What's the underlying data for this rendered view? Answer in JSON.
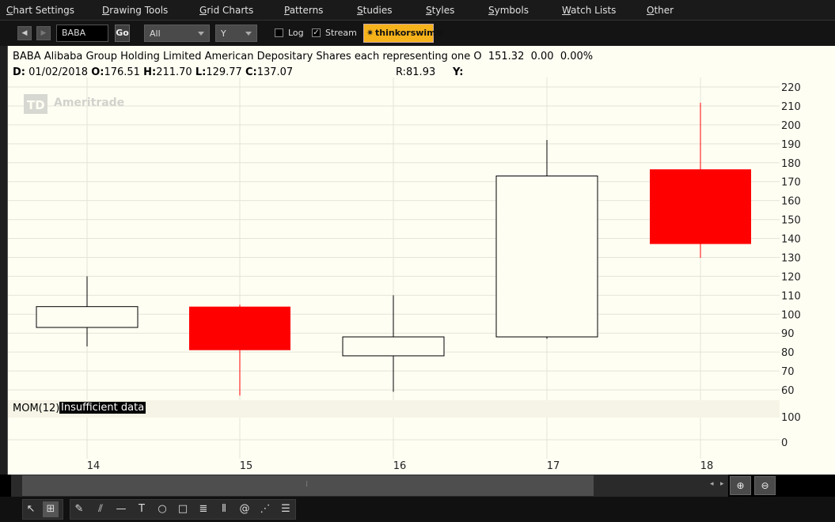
{
  "menu": [
    {
      "label": "Chart Settings",
      "ul": "C",
      "rest": "hart Settings"
    },
    {
      "label": "Drawing Tools",
      "ul": "D",
      "rest": "rawing Tools"
    },
    {
      "label": "Grid Charts",
      "ul": "G",
      "rest": "rid Charts"
    },
    {
      "label": "Patterns",
      "ul": "P",
      "rest": "atterns"
    },
    {
      "label": "Studies",
      "ul": "S",
      "rest": "tudies"
    },
    {
      "label": "Styles",
      "ul": "S",
      "rest": "tyles"
    },
    {
      "label": "Symbols",
      "ul": "S",
      "rest": "ymbols"
    },
    {
      "label": "Watch Lists",
      "ul": "W",
      "rest": "atch Lists"
    },
    {
      "label": "Other",
      "ul": "O",
      "rest": "ther"
    }
  ],
  "toolbar": {
    "symbol_value": "BABA",
    "go_label": "Go",
    "period_value": "All",
    "aggregation_value": "Y",
    "log_label": "Log",
    "log_checked": false,
    "stream_label": "Stream",
    "stream_checked": true,
    "brand_label": "thinkorswim®"
  },
  "header": {
    "title_line": "BABA Alibaba Group Holding Limited American Depositary Shares each representing one O",
    "last": "151.32",
    "change": "0.00",
    "change_pct": "0.00%",
    "date_label": "D:",
    "date": "01/02/2018",
    "open_label": "O:",
    "open": "176.51",
    "high_label": "H:",
    "high": "211.70",
    "low_label": "L:",
    "low": "129.77",
    "close_label": "C:",
    "close": "137.07",
    "r_label": "R:",
    "r_value": "81.93",
    "y_label": "Y:"
  },
  "watermark": {
    "brand_letters": "TD",
    "brand_name": "Ameritrade"
  },
  "study": {
    "label": "MOM(12)",
    "status": "Insufficient data",
    "y_ticks": [
      "100",
      "0"
    ]
  },
  "colors": {
    "down": "#ff0000",
    "up": "#fffef3",
    "background": "#fffef3",
    "grid": "#e4e4d8"
  },
  "chart_data": {
    "type": "candlestick",
    "x": [
      "14",
      "15",
      "16",
      "17",
      "18"
    ],
    "ohlc": [
      {
        "x": "14",
        "open": 93,
        "high": 120,
        "low": 83,
        "close": 104,
        "direction": "up"
      },
      {
        "x": "15",
        "open": 104,
        "high": 105,
        "low": 57,
        "close": 81,
        "direction": "down"
      },
      {
        "x": "16",
        "open": 78,
        "high": 110,
        "low": 59,
        "close": 88,
        "direction": "up"
      },
      {
        "x": "17",
        "open": 88,
        "high": 192,
        "low": 87,
        "close": 173,
        "direction": "up"
      },
      {
        "x": "18",
        "open": 176.51,
        "high": 211.7,
        "low": 129.77,
        "close": 137.07,
        "direction": "down"
      }
    ],
    "y_ticks": [
      60,
      70,
      80,
      90,
      100,
      110,
      120,
      130,
      140,
      150,
      160,
      170,
      180,
      190,
      200,
      210,
      220
    ],
    "ylim": [
      57,
      223
    ],
    "grid": true
  }
}
